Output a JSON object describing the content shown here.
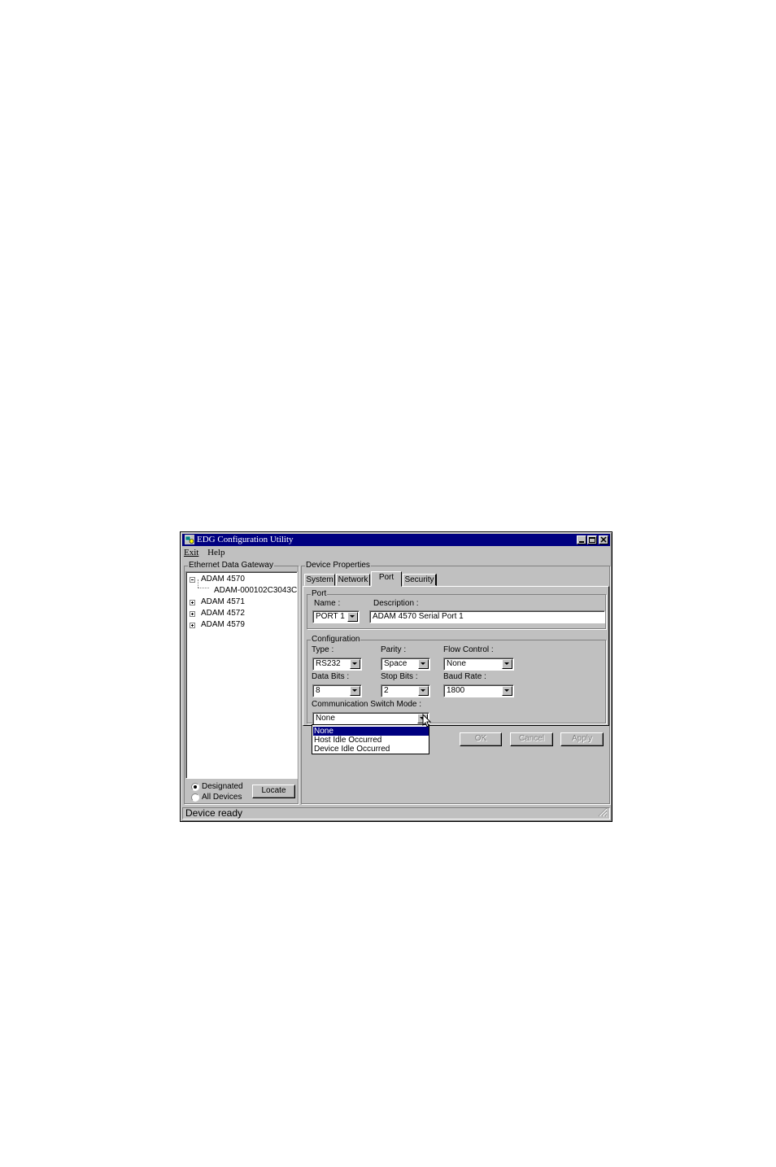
{
  "window": {
    "title": "EDG Configuration Utility",
    "controls": [
      "minimize-icon",
      "maximize-icon",
      "close-icon"
    ]
  },
  "menu": [
    "Exit",
    "Help"
  ],
  "left_panel": {
    "group_title": "Ethernet Data Gateway",
    "tree": [
      {
        "label": "ADAM 4570",
        "expanded": true,
        "children": [
          "ADAM-000102C3043C"
        ]
      },
      {
        "label": "ADAM 4571",
        "expanded": false
      },
      {
        "label": "ADAM 4572",
        "expanded": false
      },
      {
        "label": "ADAM 4579",
        "expanded": false
      }
    ],
    "radio_designated": "Designated",
    "radio_all": "All Devices",
    "selected_radio": "Designated",
    "locate_button": "Locate"
  },
  "right_panel": {
    "group_title": "Device Properties",
    "tabs": [
      "System",
      "Network",
      "Port",
      "Security"
    ],
    "active_tab": "Port",
    "port_group": {
      "title": "Port",
      "name_label": "Name :",
      "name_value": "PORT 1",
      "description_label": "Description :",
      "description_value": "ADAM 4570 Serial Port 1"
    },
    "config_group": {
      "title": "Configuration",
      "type_label": "Type :",
      "type_value": "RS232",
      "parity_label": "Parity :",
      "parity_value": "Space",
      "flow_label": "Flow Control :",
      "flow_value": "None",
      "databits_label": "Data Bits :",
      "databits_value": "8",
      "stopbits_label": "Stop Bits :",
      "stopbits_value": "2",
      "baud_label": "Baud Rate :",
      "baud_value": "1800",
      "switch_label": "Communication Switch Mode :",
      "switch_value": "None",
      "switch_options": [
        "None",
        "Host Idle Occurred",
        "Device Idle Occurred"
      ]
    },
    "buttons": {
      "ok": "OK",
      "cancel": "Cancel",
      "apply": "Apply"
    }
  },
  "status_bar": "Device ready"
}
